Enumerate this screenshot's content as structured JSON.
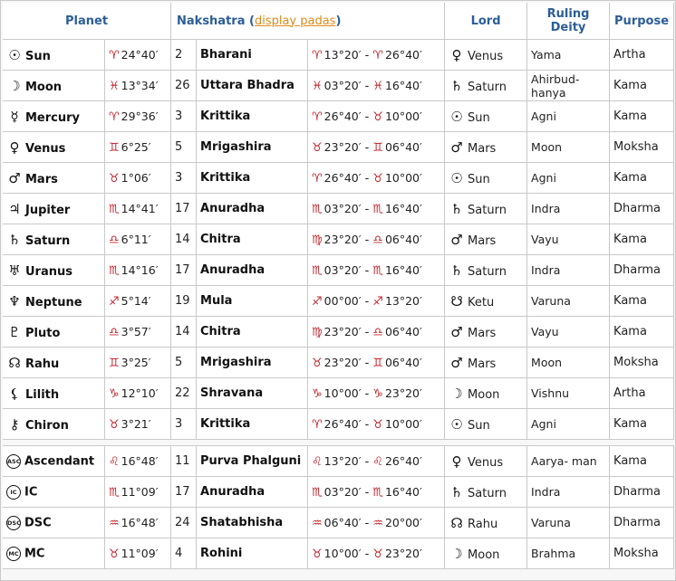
{
  "headers": {
    "planet": "Planet",
    "nakshatra": "Nakshatra (",
    "display_padas": "display padas",
    "nakshatra_close": ")",
    "lord": "Lord",
    "ruling_deity": "Ruling Deity",
    "purpose": "Purpose"
  },
  "rows": [
    {
      "glyph": "☉",
      "planet": "Sun",
      "sign": "♈",
      "pos": "24°40′",
      "num": "2",
      "nakshatra": "Bharani",
      "from_sign": "♈",
      "from": "13°20′",
      "to_sign": "♈",
      "to": "26°40′",
      "lord_glyph": "♀",
      "lord": "Venus",
      "deity": "Yama",
      "purpose": "Artha"
    },
    {
      "glyph": "☽",
      "planet": "Moon",
      "sign": "♓",
      "pos": "13°34′",
      "num": "26",
      "nakshatra": "Uttara Bhadra",
      "from_sign": "♓",
      "from": "03°20′",
      "to_sign": "♓",
      "to": "16°40′",
      "lord_glyph": "♄",
      "lord": "Saturn",
      "deity": "Ahirbud-hanya",
      "purpose": "Kama"
    },
    {
      "glyph": "☿",
      "planet": "Mercury",
      "sign": "♈",
      "pos": "29°36′",
      "num": "3",
      "nakshatra": "Krittika",
      "from_sign": "♈",
      "from": "26°40′",
      "to_sign": "♉",
      "to": "10°00′",
      "lord_glyph": "☉",
      "lord": "Sun",
      "deity": "Agni",
      "purpose": "Kama"
    },
    {
      "glyph": "♀",
      "planet": "Venus",
      "sign": "♊",
      "pos": "6°25′",
      "num": "5",
      "nakshatra": "Mrigashira",
      "from_sign": "♉",
      "from": "23°20′",
      "to_sign": "♊",
      "to": "06°40′",
      "lord_glyph": "♂",
      "lord": "Mars",
      "deity": "Moon",
      "purpose": "Moksha"
    },
    {
      "glyph": "♂",
      "planet": "Mars",
      "sign": "♉",
      "pos": "1°06′",
      "num": "3",
      "nakshatra": "Krittika",
      "from_sign": "♈",
      "from": "26°40′",
      "to_sign": "♉",
      "to": "10°00′",
      "lord_glyph": "☉",
      "lord": "Sun",
      "deity": "Agni",
      "purpose": "Kama"
    },
    {
      "glyph": "♃",
      "planet": "Jupiter",
      "sign": "♏",
      "pos": "14°41′",
      "num": "17",
      "nakshatra": "Anuradha",
      "from_sign": "♏",
      "from": "03°20′",
      "to_sign": "♏",
      "to": "16°40′",
      "lord_glyph": "♄",
      "lord": "Saturn",
      "deity": "Indra",
      "purpose": "Dharma"
    },
    {
      "glyph": "♄",
      "planet": "Saturn",
      "sign": "♎",
      "pos": "6°11′",
      "num": "14",
      "nakshatra": "Chitra",
      "from_sign": "♍",
      "from": "23°20′",
      "to_sign": "♎",
      "to": "06°40′",
      "lord_glyph": "♂",
      "lord": "Mars",
      "deity": "Vayu",
      "purpose": "Kama"
    },
    {
      "glyph": "♅",
      "planet": "Uranus",
      "sign": "♏",
      "pos": "14°16′",
      "num": "17",
      "nakshatra": "Anuradha",
      "from_sign": "♏",
      "from": "03°20′",
      "to_sign": "♏",
      "to": "16°40′",
      "lord_glyph": "♄",
      "lord": "Saturn",
      "deity": "Indra",
      "purpose": "Dharma"
    },
    {
      "glyph": "♆",
      "planet": "Neptune",
      "sign": "♐",
      "pos": "5°14′",
      "num": "19",
      "nakshatra": "Mula",
      "from_sign": "♐",
      "from": "00°00′",
      "to_sign": "♐",
      "to": "13°20′",
      "lord_glyph": "☋",
      "lord": "Ketu",
      "deity": "Varuna",
      "purpose": "Kama"
    },
    {
      "glyph": "♇",
      "planet": "Pluto",
      "sign": "♎",
      "pos": "3°57′",
      "num": "14",
      "nakshatra": "Chitra",
      "from_sign": "♍",
      "from": "23°20′",
      "to_sign": "♎",
      "to": "06°40′",
      "lord_glyph": "♂",
      "lord": "Mars",
      "deity": "Vayu",
      "purpose": "Kama"
    },
    {
      "glyph": "☊",
      "planet": "Rahu",
      "sign": "♊",
      "pos": "3°25′",
      "num": "5",
      "nakshatra": "Mrigashira",
      "from_sign": "♉",
      "from": "23°20′",
      "to_sign": "♊",
      "to": "06°40′",
      "lord_glyph": "♂",
      "lord": "Mars",
      "deity": "Moon",
      "purpose": "Moksha"
    },
    {
      "glyph": "⚸",
      "planet": "Lilith",
      "sign": "♑",
      "pos": "12°10′",
      "num": "22",
      "nakshatra": "Shravana",
      "from_sign": "♑",
      "from": "10°00′",
      "to_sign": "♑",
      "to": "23°20′",
      "lord_glyph": "☽",
      "lord": "Moon",
      "deity": "Vishnu",
      "purpose": "Artha"
    },
    {
      "glyph": "⚷",
      "planet": "Chiron",
      "sign": "♉",
      "pos": "3°21′",
      "num": "3",
      "nakshatra": "Krittika",
      "from_sign": "♈",
      "from": "26°40′",
      "to_sign": "♉",
      "to": "10°00′",
      "lord_glyph": "☉",
      "lord": "Sun",
      "deity": "Agni",
      "purpose": "Kama"
    }
  ],
  "angles": [
    {
      "badge": "ASC",
      "planet": "Ascendant",
      "sign": "♌",
      "pos": "16°48′",
      "num": "11",
      "nakshatra": "Purva Phalguni",
      "from_sign": "♌",
      "from": "13°20′",
      "to_sign": "♌",
      "to": "26°40′",
      "lord_glyph": "♀",
      "lord": "Venus",
      "deity": "Aarya- man",
      "purpose": "Kama"
    },
    {
      "badge": "IC",
      "planet": "IC",
      "sign": "♏",
      "pos": "11°09′",
      "num": "17",
      "nakshatra": "Anuradha",
      "from_sign": "♏",
      "from": "03°20′",
      "to_sign": "♏",
      "to": "16°40′",
      "lord_glyph": "♄",
      "lord": "Saturn",
      "deity": "Indra",
      "purpose": "Dharma"
    },
    {
      "badge": "DSC",
      "planet": "DSC",
      "sign": "♒",
      "pos": "16°48′",
      "num": "24",
      "nakshatra": "Shatabhisha",
      "from_sign": "♒",
      "from": "06°40′",
      "to_sign": "♒",
      "to": "20°00′",
      "lord_glyph": "☊",
      "lord": "Rahu",
      "deity": "Varuna",
      "purpose": "Dharma"
    },
    {
      "badge": "MC",
      "planet": "MC",
      "sign": "♉",
      "pos": "11°09′",
      "num": "4",
      "nakshatra": "Rohini",
      "from_sign": "♉",
      "from": "10°00′",
      "to_sign": "♉",
      "to": "23°20′",
      "lord_glyph": "☽",
      "lord": "Moon",
      "deity": "Brahma",
      "purpose": "Moksha"
    }
  ]
}
